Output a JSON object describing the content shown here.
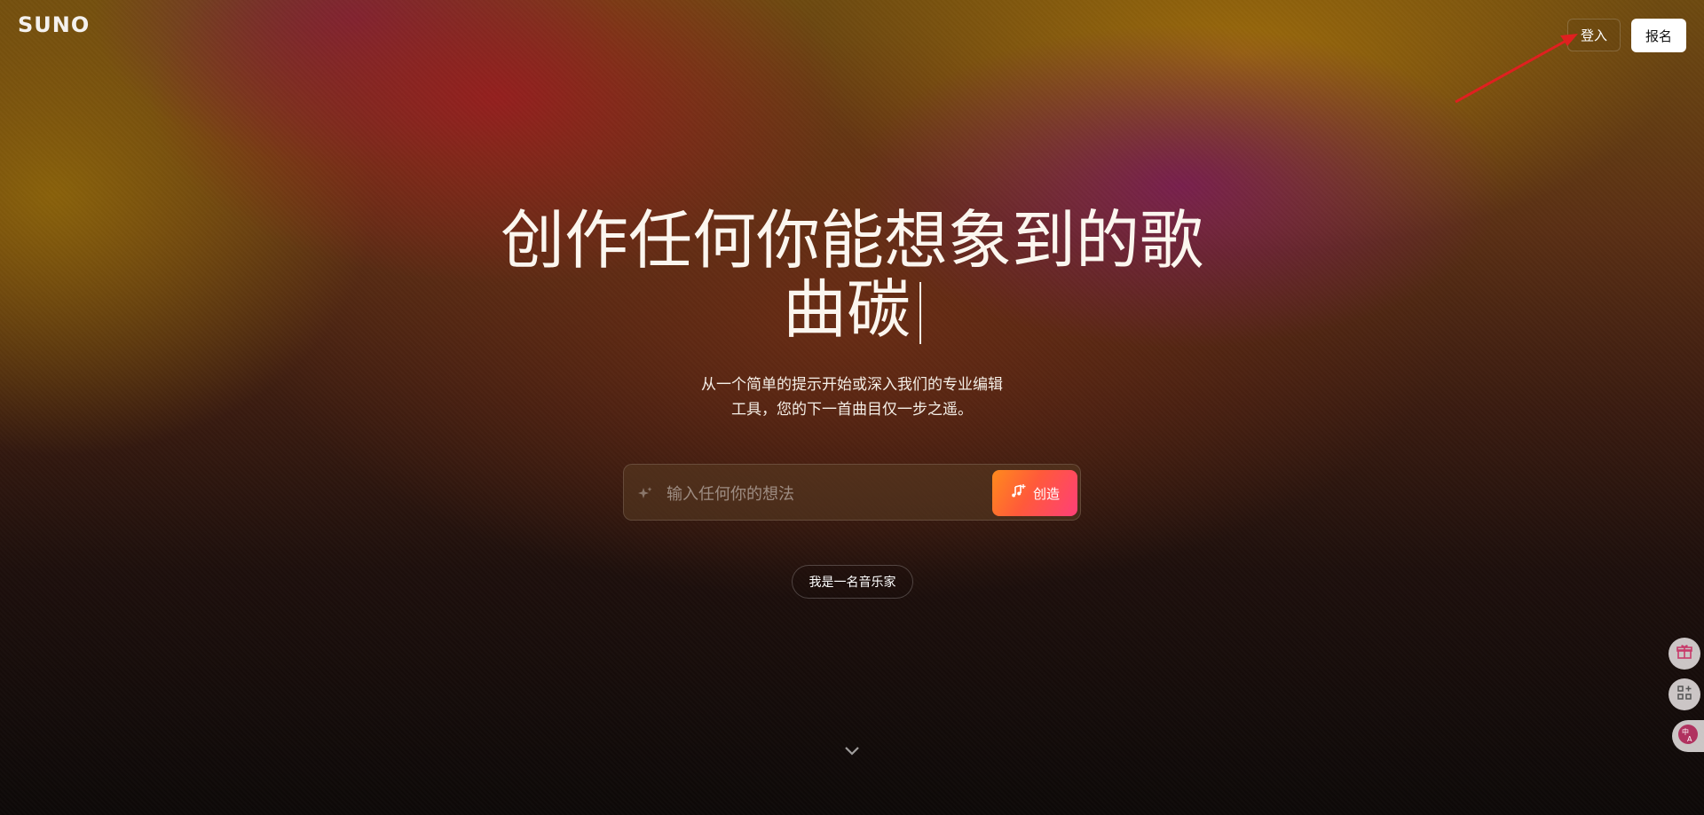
{
  "header": {
    "logo": "SUNO",
    "login_label": "登入",
    "signup_label": "报名"
  },
  "hero": {
    "title_line1": "创作任何你能想象到的歌",
    "title_line2": "曲碳",
    "subtitle_line1": "从一个简单的提示开始或深入我们的专业编辑",
    "subtitle_line2": "工具，您的下一首曲目仅一步之遥。"
  },
  "prompt": {
    "placeholder": "输入任何你的想法",
    "value": "",
    "create_label": "创造"
  },
  "musician_pill": {
    "label": "我是一名音乐家"
  },
  "side_tools": {
    "icons": [
      "gift-icon",
      "apps-icon",
      "translate-icon"
    ]
  },
  "colors": {
    "accent_gradient_start": "#ff8a1d",
    "accent_gradient_end": "#ff3f78",
    "annotation_arrow": "#e02020"
  }
}
